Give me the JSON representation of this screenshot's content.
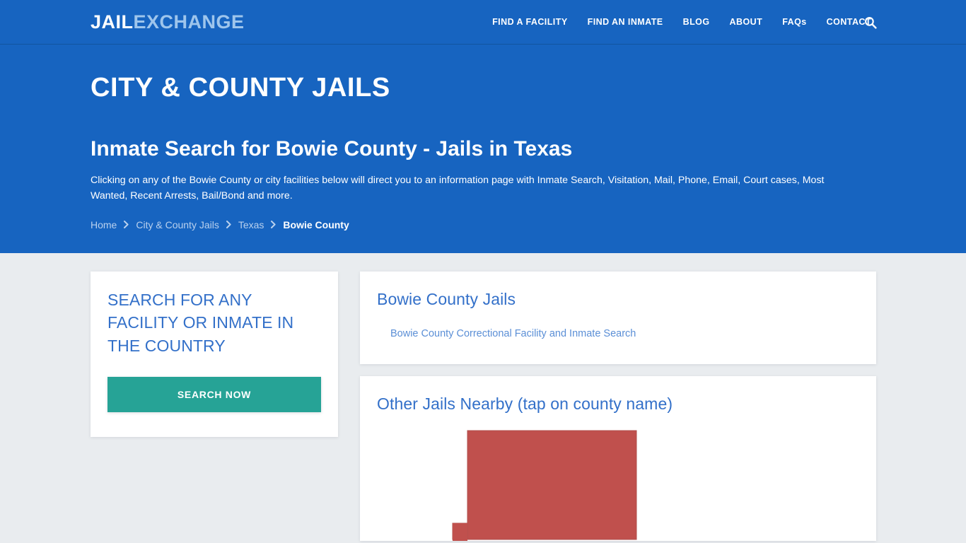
{
  "navbar": {
    "logo_part1": "JAIL",
    "logo_part2": "EXCHANGE",
    "links": [
      {
        "label": "FIND A FACILITY"
      },
      {
        "label": "FIND AN INMATE"
      },
      {
        "label": "BLOG"
      },
      {
        "label": "ABOUT"
      },
      {
        "label": "FAQs"
      },
      {
        "label": "CONTACT"
      }
    ],
    "search_icon": "search-icon"
  },
  "hero": {
    "title": "CITY & COUNTY JAILS",
    "subtitle": "Inmate Search for Bowie County - Jails in Texas",
    "description": "Clicking on any of the Bowie County or city facilities below will direct you to an information page with Inmate Search, Visitation, Mail, Phone, Email, Court cases, Most Wanted, Recent Arrests, Bail/Bond and more.",
    "breadcrumb": [
      {
        "label": "Home",
        "current": false
      },
      {
        "label": "City & County Jails",
        "current": false
      },
      {
        "label": "Texas",
        "current": false
      },
      {
        "label": "Bowie County",
        "current": true
      }
    ]
  },
  "search_card": {
    "title": "SEARCH FOR ANY FACILITY OR INMATE IN THE COUNTRY",
    "button_label": "SEARCH NOW"
  },
  "jails_card": {
    "title": "Bowie County Jails",
    "items": [
      {
        "label": "Bowie County Correctional Facility and Inmate Search"
      }
    ]
  },
  "nearby_card": {
    "title": "Other Jails Nearby (tap on county name)",
    "map_shape_color": "#c0504d"
  },
  "colors": {
    "header_blue": "#1764c0",
    "page_bg": "#e9ecef",
    "heading_blue": "#3370c9",
    "link_blue": "#5b8fd6",
    "teal": "#26a396",
    "map_red": "#c0504d"
  }
}
